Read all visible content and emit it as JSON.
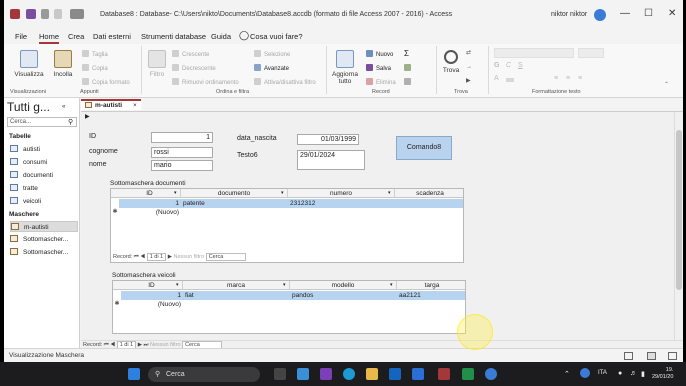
{
  "titlebar": {
    "title": "Database8 : Database- C:\\Users\\nikto\\Documents\\Database8.accdb (formato di file Access 2007 - 2016) - Access",
    "user": "niktor niktor",
    "min": "—",
    "max": "☐",
    "close": "✕"
  },
  "menu": [
    "File",
    "Home",
    "Crea",
    "Dati esterni",
    "Strumenti database",
    "Guida"
  ],
  "search_hint": "Cosa vuoi fare?",
  "ribbon": {
    "visualizza": "Visualizza",
    "incolla": "Incolla",
    "taglia": "Taglia",
    "copia": "Copia",
    "copia_formato": "Copia formato",
    "filtro": "Filtro",
    "crescente": "Crescente",
    "decrescente": "Decrescente",
    "rimuovi_ordinamento": "Rimuovi ordinamento",
    "selezione": "Selezione",
    "avanzate": "Avanzate",
    "attiva_filtro": "Attiva/disattiva filtro",
    "aggiorna_tutto": "Aggiorna tutto",
    "nuovo": "Nuovo",
    "salva": "Salva",
    "elimina": "Elimina",
    "trova": "Trova",
    "groups": {
      "visualizzazioni": "Visualizzazioni",
      "appunti": "Appunti",
      "ordina": "Ordina e filtra",
      "record": "Record",
      "trova": "Trova",
      "formattazione": "Formattazione testo"
    }
  },
  "nav": {
    "title": "Tutti g...",
    "search_placeholder": "Cerca...",
    "tables_header": "Tabelle",
    "tables": [
      "autisti",
      "consumi",
      "documenti",
      "tratte",
      "veicoli"
    ],
    "forms_header": "Maschere",
    "forms": [
      "m-autisti",
      "Sottomascher...",
      "Sottomascher..."
    ]
  },
  "doc_tab": "m-autisti",
  "form": {
    "id_label": "ID",
    "id_value": "1",
    "cognome_label": "cognome",
    "cognome_value": "rossi",
    "nome_label": "nome",
    "nome_value": "mario",
    "data_nascita_label": "data_nascita",
    "data_nascita_value": "01/03/1999",
    "testo6_label": "Testo6",
    "testo6_value": "29/01/2024",
    "command_label": "Comando8"
  },
  "sub_documenti": {
    "title": "Sottomaschera documenti",
    "headers": [
      "ID",
      "documento",
      "numero",
      "scadenza"
    ],
    "row": {
      "id": "1",
      "documento": "patente",
      "numero": "2312312",
      "scadenza": ""
    },
    "new_row": "(Nuovo)",
    "nav_record_label": "Record:",
    "nav_position": "1 di 1",
    "nav_filter": "Nessun filtro",
    "nav_search": "Cerca"
  },
  "sub_veicoli": {
    "title": "Sottomaschera veicoli",
    "headers": [
      "ID",
      "marca",
      "modello",
      "targa"
    ],
    "row": {
      "id": "1",
      "marca": "fiat",
      "modello": "pandos",
      "targa": "aa2121"
    },
    "new_row": "(Nuovo)"
  },
  "main_nav": {
    "record_label": "Record:",
    "position": "1 di 1",
    "filter": "Nessun filtro",
    "search": "Cerca"
  },
  "status": "Visualizzazione Maschera",
  "taskbar": {
    "search": "Cerca",
    "lang": "ITA",
    "time": "19.",
    "date": "29/01/20"
  },
  "colors": {
    "accent": "#a4373a",
    "selection": "#b6d3f0",
    "button": "#b9d3ee"
  }
}
